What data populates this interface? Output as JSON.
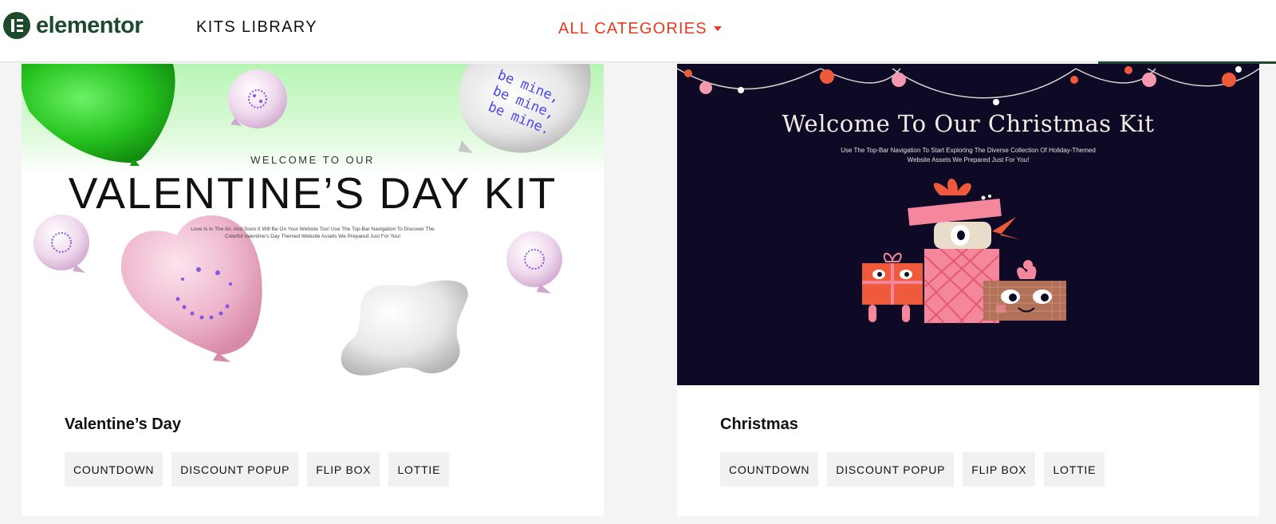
{
  "header": {
    "logo_text": "elementor",
    "nav_kits": "KITS LIBRARY",
    "nav_categories": "ALL CATEGORIES"
  },
  "colors": {
    "brand_green": "#1d4a2d",
    "accent_red": "#e8391c",
    "page_bg": "#f4f4f4",
    "tag_bg": "#f1f1f1"
  },
  "cards": [
    {
      "title": "Valentine’s Day",
      "thumbnail": {
        "subtitle": "WELCOME TO OUR",
        "headline": "VALENTINE’S DAY KIT",
        "description": "Love Is In The Air, And Soon It Will Be On Your Website Too! Use The Top-Bar Navigation To Discover The Colorful Valentine’s Day Themed Website Assets We Prepared Just For You!",
        "balloon_text": "be mine, be mine, be mine."
      },
      "tags": [
        "COUNTDOWN",
        "DISCOUNT POPUP",
        "FLIP BOX",
        "LOTTIE"
      ]
    },
    {
      "title": "Christmas",
      "thumbnail": {
        "headline": "Welcome To Our Christmas Kit",
        "description": "Use The Top-Bar Navigation To Start Exploring The Diverse Collection Of Holiday-Themed Website Assets We Prepared Just For You!"
      },
      "tags": [
        "COUNTDOWN",
        "DISCOUNT POPUP",
        "FLIP BOX",
        "LOTTIE"
      ]
    }
  ]
}
